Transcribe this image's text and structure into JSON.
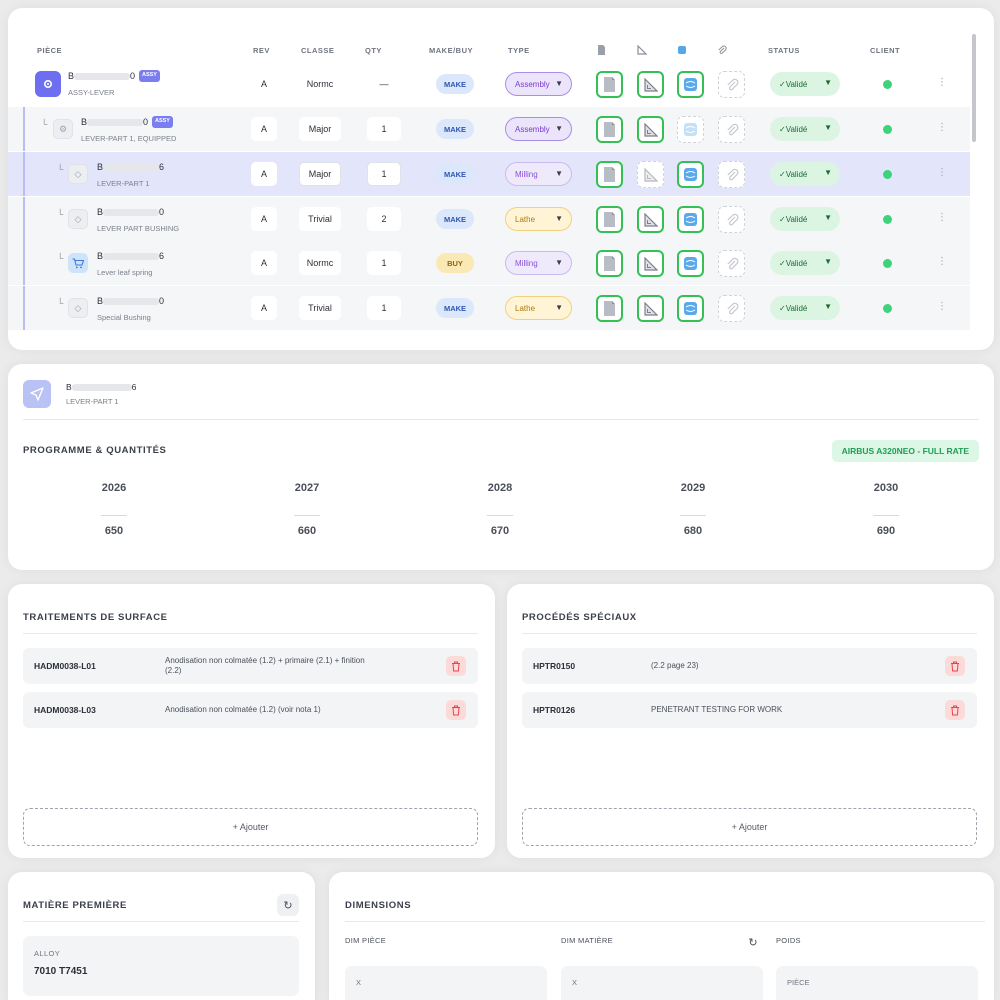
{
  "bom": {
    "columns": {
      "piece": "PIÈCE",
      "rev": "REV",
      "classe": "CLASSE",
      "qty": "QTY",
      "make_buy": "MAKE/BUY",
      "type": "TYPE",
      "status": "STATUS",
      "client": "CLIENT"
    },
    "rows": [
      {
        "ref_start": "B",
        "ref_end": "0",
        "assy": "ASSY",
        "name": "ASSY-LEVER",
        "rev": "A",
        "classe": "Normc",
        "qty": "—",
        "make_buy": "MAKE",
        "type": "Assembly",
        "status": "✓Validé"
      },
      {
        "ref_start": "B",
        "ref_end": "0",
        "assy": "ASSY",
        "name": "LEVER-PART 1, EQUIPPED",
        "rev": "A",
        "classe": "Major",
        "qty": "1",
        "make_buy": "MAKE",
        "type": "Assembly",
        "status": "✓Validé"
      },
      {
        "ref_start": "B",
        "ref_end": "6",
        "name": "LEVER-PART 1",
        "rev": "A",
        "classe": "Major",
        "qty": "1",
        "make_buy": "MAKE",
        "type": "Milling",
        "status": "✓Validé"
      },
      {
        "ref_start": "B",
        "ref_end": "0",
        "name": "LEVER PART BUSHING",
        "rev": "A",
        "classe": "Trivial",
        "qty": "2",
        "make_buy": "MAKE",
        "type": "Lathe",
        "status": "✓Validé"
      },
      {
        "ref_start": "B",
        "ref_end": "6",
        "name": "Lever leaf spring",
        "rev": "A",
        "classe": "Normc",
        "qty": "1",
        "make_buy": "BUY",
        "type": "Milling",
        "status": "✓Validé"
      },
      {
        "ref_start": "B",
        "ref_end": "0",
        "name": "Special Bushing",
        "rev": "A",
        "classe": "Trivial",
        "qty": "1",
        "make_buy": "MAKE",
        "type": "Lathe",
        "status": "✓Validé"
      }
    ]
  },
  "detail": {
    "ref_start": "B",
    "ref_end": "6",
    "name": "LEVER-PART 1",
    "programme_title": "PROGRAMME & QUANTITÉS",
    "programme_badge": "AIRBUS A320NEO - FULL RATE",
    "years": [
      {
        "year": "2026",
        "qty": "650"
      },
      {
        "year": "2027",
        "qty": "660"
      },
      {
        "year": "2028",
        "qty": "670"
      },
      {
        "year": "2029",
        "qty": "680"
      },
      {
        "year": "2030",
        "qty": "690"
      }
    ]
  },
  "surface": {
    "title": "TRAITEMENTS DE SURFACE",
    "items": [
      {
        "code": "HADM0038-L01",
        "desc": "Anodisation non colmatée (1.2) + primaire (2.1) + finition (2.2)"
      },
      {
        "code": "HADM0038-L03",
        "desc": "Anodisation non colmatée (1.2) (voir nota 1)"
      }
    ],
    "add_label": "+ Ajouter"
  },
  "special": {
    "title": "PROCÉDÉS SPÉCIAUX",
    "items": [
      {
        "code": "HPTR0150",
        "desc": "(2.2 page 23)"
      },
      {
        "code": "HPTR0126",
        "desc": "PENETRANT TESTING FOR WORK"
      }
    ],
    "add_label": "+ Ajouter"
  },
  "material": {
    "title": "MATIÈRE PREMIÈRE",
    "alloy_label": "ALLOY",
    "alloy_value": "7010 T7451"
  },
  "dimensions": {
    "title": "DIMENSIONS",
    "dim_piece": "DIM PIÈCE",
    "dim_matiere": "DIM MATIÈRE",
    "poids": "POIDS",
    "x_label": "X",
    "piece_label": "PIÈCE"
  },
  "colors": {
    "accent": "#6d6ff0",
    "make": "#2f55b5",
    "buy": "#8d6508",
    "valid": "#1c6b33",
    "client_ok": "#3ed37b"
  }
}
